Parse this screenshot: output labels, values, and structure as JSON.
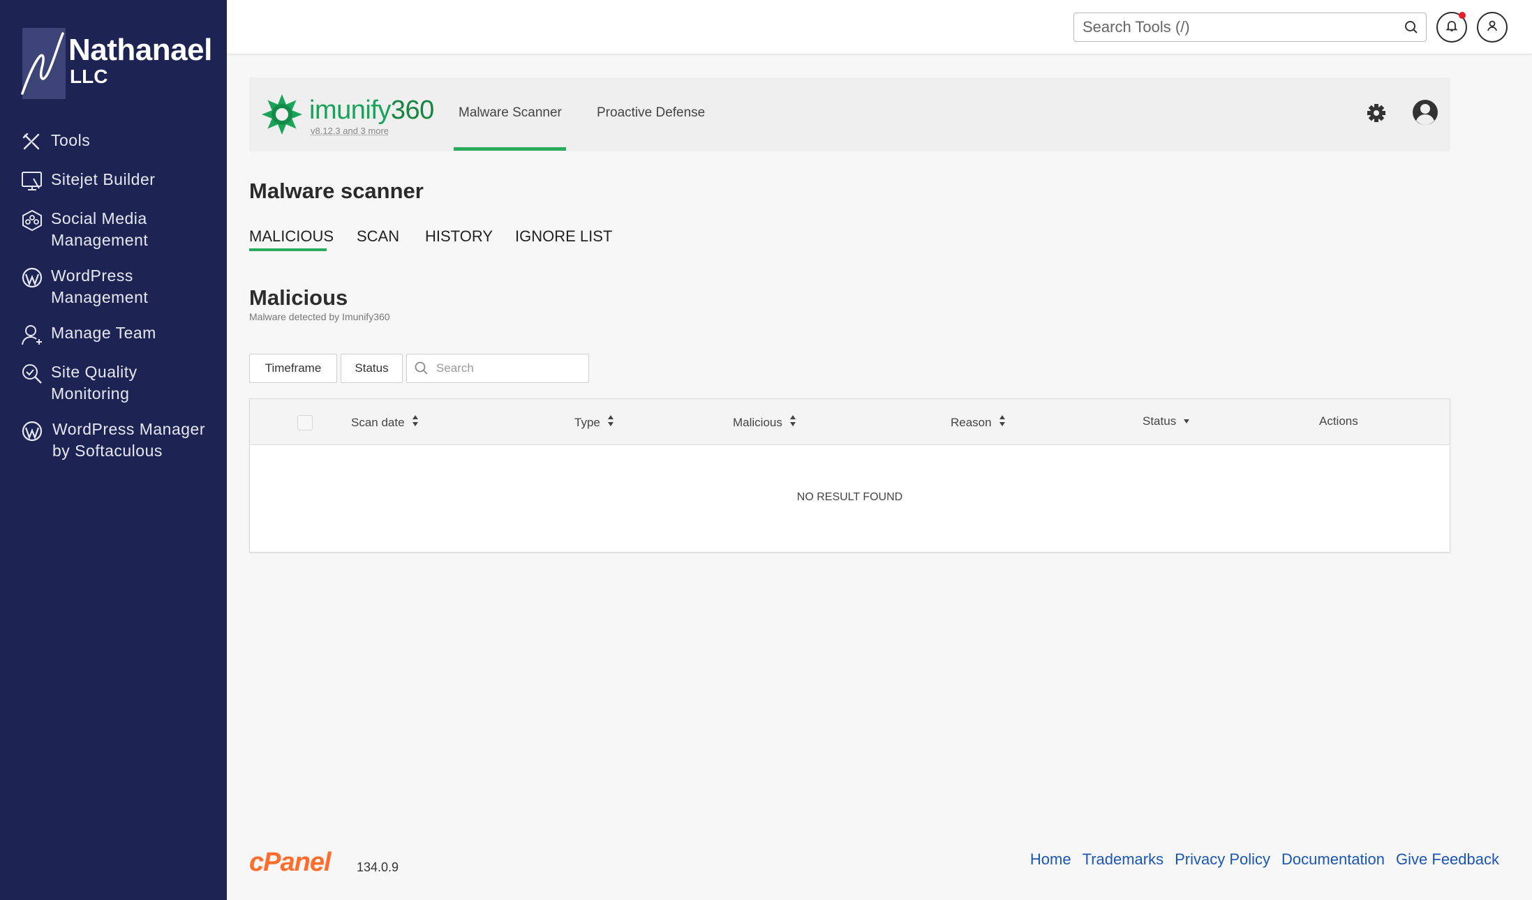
{
  "brand": {
    "name": "Nathanael",
    "sub": "LLC"
  },
  "sidebar": {
    "items": [
      {
        "label": "Tools",
        "icon": "tools-icon"
      },
      {
        "label": "Sitejet Builder",
        "icon": "monitor-icon"
      },
      {
        "label": "Social Media Management",
        "icon": "social-icon"
      },
      {
        "label": "WordPress Management",
        "icon": "wordpress-icon"
      },
      {
        "label": "Manage Team",
        "icon": "user-plus-icon"
      },
      {
        "label": "Site Quality Monitoring",
        "icon": "search-check-icon"
      },
      {
        "label": "WordPress Manager by Softaculous",
        "icon": "wordpress-icon"
      }
    ]
  },
  "topbar": {
    "search_placeholder": "Search Tools (/)",
    "notifications_unread": true
  },
  "imunify": {
    "name_prefix": "imunify",
    "name_suffix": "360",
    "version": "v8.12.3 and 3 more",
    "tabs": [
      "Malware Scanner",
      "Proactive Defense"
    ],
    "active_tab": "Malware Scanner"
  },
  "page": {
    "title": "Malware scanner",
    "subtabs": [
      "MALICIOUS",
      "SCAN",
      "HISTORY",
      "IGNORE LIST"
    ],
    "active_subtab": "MALICIOUS",
    "section_title": "Malicious",
    "section_subtitle": "Malware detected by Imunify360"
  },
  "filters": {
    "timeframe_label": "Timeframe",
    "status_label": "Status",
    "search_placeholder": "Search"
  },
  "table": {
    "columns": [
      "Scan date",
      "Type",
      "Malicious",
      "Reason",
      "Status",
      "Actions"
    ],
    "empty_text": "NO RESULT FOUND"
  },
  "footer": {
    "cpanel_version": "134.0.9",
    "links": [
      "Home",
      "Trademarks",
      "Privacy Policy",
      "Documentation",
      "Give Feedback"
    ]
  },
  "colors": {
    "sidebar_bg": "#1d2453",
    "accent_green": "#2aab5c",
    "cpanel_orange": "#ff6c2c",
    "link_blue": "#1b55b5"
  }
}
